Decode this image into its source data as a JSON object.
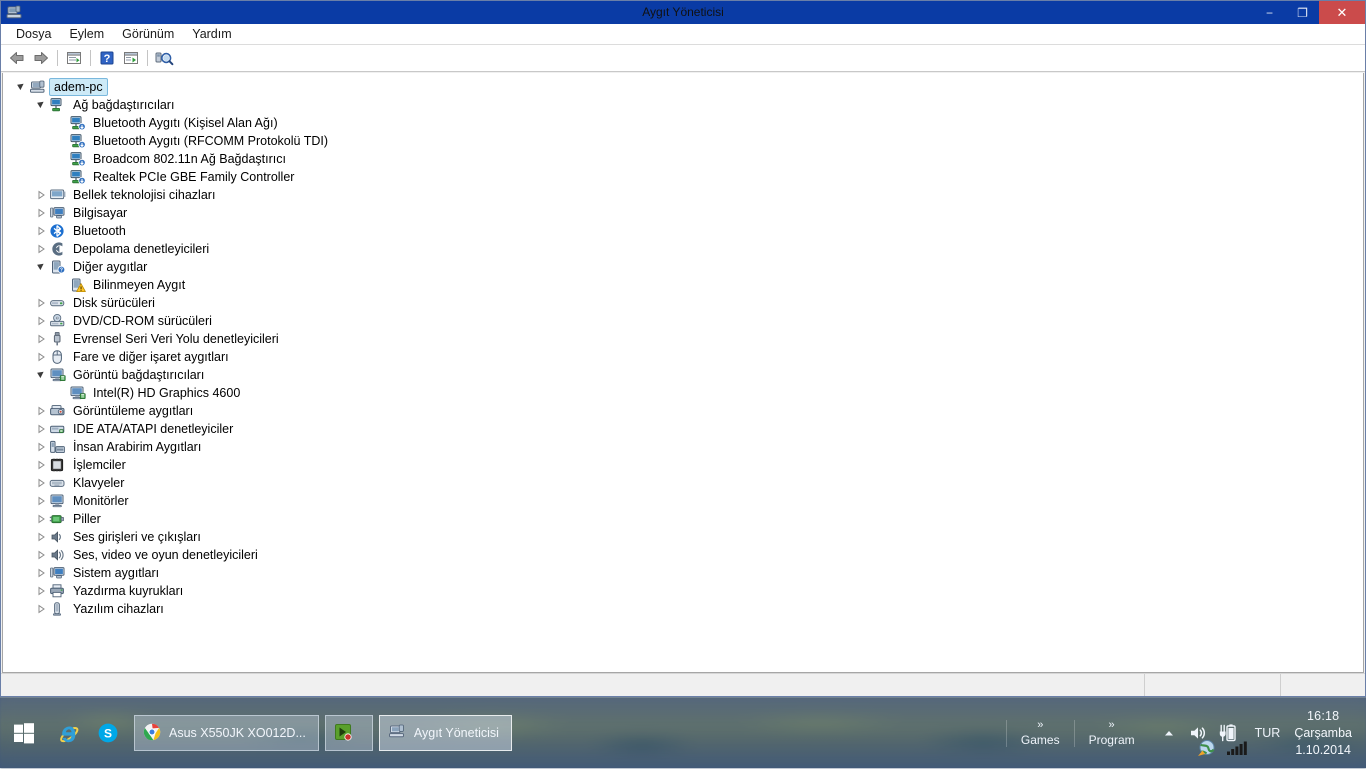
{
  "window": {
    "title": "Aygıt Yöneticisi",
    "icon": "device-manager-icon",
    "minimize_label": "−",
    "maximize_label": "❐",
    "close_label": "✕"
  },
  "menubar": {
    "items": [
      {
        "label": "Dosya",
        "name": "menu-dosya"
      },
      {
        "label": "Eylem",
        "name": "menu-eylem"
      },
      {
        "label": "Görünüm",
        "name": "menu-gorunum"
      },
      {
        "label": "Yardım",
        "name": "menu-yardim"
      }
    ]
  },
  "toolbar": {
    "buttons": [
      {
        "icon": "back-arrow-icon",
        "tooltip": "Geri"
      },
      {
        "icon": "forward-arrow-icon",
        "tooltip": "İleri"
      },
      {
        "icon": "properties-panel-icon",
        "tooltip": "Özellikler"
      },
      {
        "icon": "help-question-icon",
        "tooltip": "Yardım"
      },
      {
        "icon": "show-panel-icon",
        "tooltip": "Göster"
      },
      {
        "icon": "scan-hardware-icon",
        "tooltip": "Donanım değişikliklerini tara"
      }
    ]
  },
  "tree": {
    "root": {
      "label": "adem-pc",
      "icon": "computer-icon",
      "state": "expanded",
      "selected": true
    },
    "nodes": [
      {
        "label": "Ağ bağdaştırıcıları",
        "icon": "network-adapter-icon",
        "state": "expanded",
        "level": 1
      },
      {
        "label": "Bluetooth Aygıtı (Kişisel Alan Ağı)",
        "icon": "network-device-icon",
        "state": "leaf",
        "level": 2
      },
      {
        "label": "Bluetooth Aygıtı (RFCOMM Protokolü TDI)",
        "icon": "network-device-icon",
        "state": "leaf",
        "level": 2
      },
      {
        "label": "Broadcom 802.11n Ağ Bağdaştırıcı",
        "icon": "network-device-icon",
        "state": "leaf",
        "level": 2
      },
      {
        "label": "Realtek PCIe GBE Family Controller",
        "icon": "network-device-icon",
        "state": "leaf",
        "level": 2
      },
      {
        "label": "Bellek teknolojisi cihazları",
        "icon": "memory-technology-icon",
        "state": "collapsed",
        "level": 1
      },
      {
        "label": "Bilgisayar",
        "icon": "computer-small-icon",
        "state": "collapsed",
        "level": 1
      },
      {
        "label": "Bluetooth",
        "icon": "bluetooth-icon",
        "state": "collapsed",
        "level": 1
      },
      {
        "label": "Depolama denetleyicileri",
        "icon": "storage-controller-icon",
        "state": "collapsed",
        "level": 1
      },
      {
        "label": "Diğer aygıtlar",
        "icon": "other-devices-icon",
        "state": "expanded",
        "level": 1
      },
      {
        "label": "Bilinmeyen Aygıt",
        "icon": "unknown-device-warning-icon",
        "state": "leaf",
        "level": 2
      },
      {
        "label": "Disk sürücüleri",
        "icon": "disk-drive-icon",
        "state": "collapsed",
        "level": 1
      },
      {
        "label": "DVD/CD-ROM sürücüleri",
        "icon": "dvd-drive-icon",
        "state": "collapsed",
        "level": 1
      },
      {
        "label": "Evrensel Seri Veri Yolu denetleyicileri",
        "icon": "usb-controller-icon",
        "state": "collapsed",
        "level": 1
      },
      {
        "label": "Fare ve diğer işaret aygıtları",
        "icon": "mouse-icon",
        "state": "collapsed",
        "level": 1
      },
      {
        "label": "Görüntü bağdaştırıcıları",
        "icon": "display-adapter-icon",
        "state": "expanded",
        "level": 1
      },
      {
        "label": "Intel(R) HD Graphics 4600",
        "icon": "display-adapter-icon",
        "state": "leaf",
        "level": 2
      },
      {
        "label": "Görüntüleme aygıtları",
        "icon": "imaging-device-icon",
        "state": "collapsed",
        "level": 1
      },
      {
        "label": "IDE ATA/ATAPI denetleyiciler",
        "icon": "ide-controller-icon",
        "state": "collapsed",
        "level": 1
      },
      {
        "label": "İnsan Arabirim Aygıtları",
        "icon": "hid-device-icon",
        "state": "collapsed",
        "level": 1
      },
      {
        "label": "İşlemciler",
        "icon": "processor-icon",
        "state": "collapsed",
        "level": 1
      },
      {
        "label": "Klavyeler",
        "icon": "keyboard-icon",
        "state": "collapsed",
        "level": 1
      },
      {
        "label": "Monitörler",
        "icon": "monitor-icon",
        "state": "collapsed",
        "level": 1
      },
      {
        "label": "Piller",
        "icon": "battery-icon",
        "state": "collapsed",
        "level": 1
      },
      {
        "label": "Ses girişleri ve çıkışları",
        "icon": "audio-io-icon",
        "state": "collapsed",
        "level": 1
      },
      {
        "label": "Ses, video ve oyun denetleyicileri",
        "icon": "sound-video-game-icon",
        "state": "collapsed",
        "level": 1
      },
      {
        "label": "Sistem aygıtları",
        "icon": "system-device-icon",
        "state": "collapsed",
        "level": 1
      },
      {
        "label": "Yazdırma kuyrukları",
        "icon": "print-queue-icon",
        "state": "collapsed",
        "level": 1
      },
      {
        "label": "Yazılım cihazları",
        "icon": "software-device-icon",
        "state": "collapsed",
        "level": 1
      }
    ]
  },
  "statusbar": {
    "pane1": "",
    "pane2": "",
    "pane3": ""
  },
  "taskbar": {
    "start_label": "Başlat",
    "quick_launch": [
      {
        "name": "internet-explorer-icon",
        "label": "Internet Explorer"
      },
      {
        "name": "skype-icon",
        "label": "Skype"
      }
    ],
    "tasks": [
      {
        "label": "Asus X550JK XO012D...",
        "icon": "chrome-icon",
        "active": false
      },
      {
        "label": "",
        "icon": "green-app-icon",
        "active": false
      },
      {
        "label": "Aygıt Yöneticisi",
        "icon": "device-manager-icon",
        "active": true
      }
    ],
    "toolbars": [
      {
        "label": "Games",
        "chevron": "»"
      },
      {
        "label": "Program",
        "chevron": "»"
      }
    ],
    "tray": {
      "show_hidden": "show-hidden-icons-arrow",
      "icons": [
        {
          "name": "volume-speaker-icon"
        },
        {
          "name": "battery-charging-icon"
        },
        {
          "name": "network-globe-icon"
        },
        {
          "name": "wifi-signal-icon"
        }
      ]
    },
    "language": "TUR",
    "clock": {
      "time": "16:18",
      "day": "Çarşamba",
      "date": "1.10.2014"
    }
  },
  "colors": {
    "titlebar": "#0a3ba5",
    "close_button": "#cb4b4b",
    "selection": "#cdeaf7",
    "selection_border": "#7ab8dd",
    "warning": "#ffc424"
  }
}
